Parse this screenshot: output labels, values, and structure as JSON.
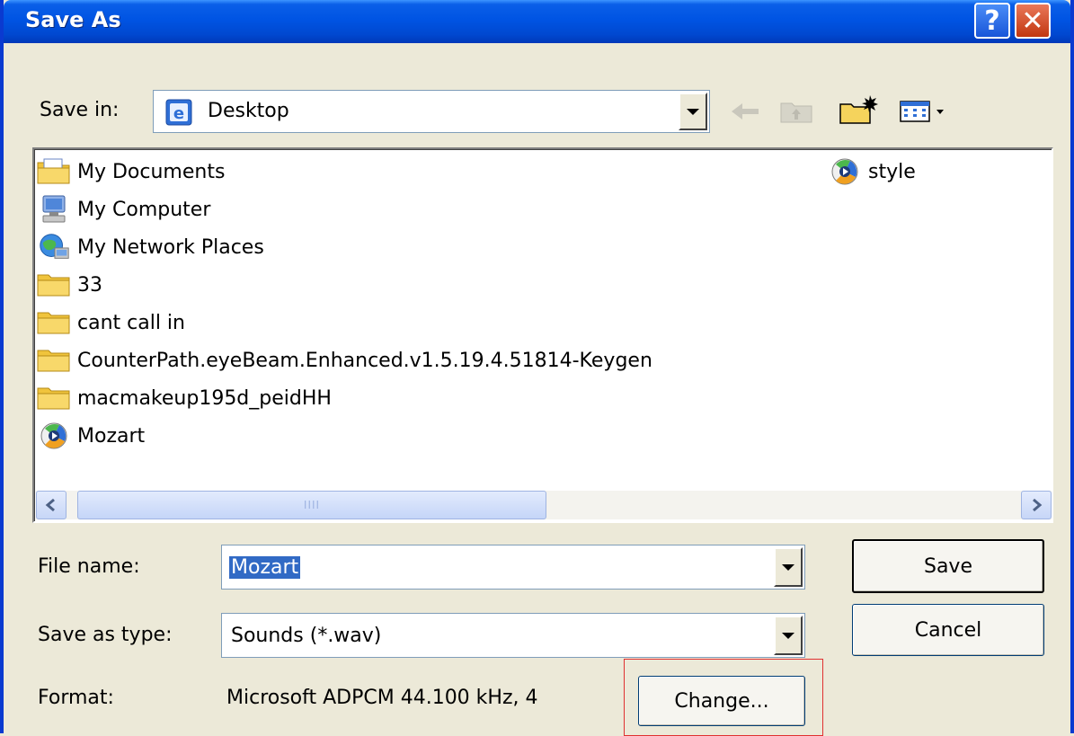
{
  "window": {
    "title": "Save As",
    "help_glyph": "?",
    "close_glyph": "✕"
  },
  "save_in": {
    "label": "Save in:",
    "value": "Desktop",
    "value_icon": "desktop-icon"
  },
  "toolbar": {
    "icons": [
      "back-arrow-icon",
      "up-folder-icon",
      "new-folder-icon",
      "views-menu-icon"
    ]
  },
  "files": {
    "left_column": [
      {
        "name": "My Documents",
        "icon": "my-documents-icon"
      },
      {
        "name": "My Computer",
        "icon": "my-computer-icon"
      },
      {
        "name": "My Network Places",
        "icon": "network-places-icon"
      },
      {
        "name": "33",
        "icon": "folder-icon"
      },
      {
        "name": "cant call in",
        "icon": "folder-icon"
      },
      {
        "name": "CounterPath.eyeBeam.Enhanced.v1.5.19.4.51814-Keygen",
        "icon": "folder-icon"
      },
      {
        "name": "macmakeup195d_peidHH",
        "icon": "folder-icon"
      },
      {
        "name": "Mozart",
        "icon": "media-file-icon"
      }
    ],
    "right_column": [
      {
        "name": "style",
        "icon": "media-file-icon"
      }
    ]
  },
  "file_name": {
    "label": "File name:",
    "value": "Mozart"
  },
  "save_as_type": {
    "label": "Save as type:",
    "value": "Sounds (*.wav)"
  },
  "format": {
    "label": "Format:",
    "value": "Microsoft ADPCM 44.100 kHz, 4"
  },
  "buttons": {
    "save": "Save",
    "cancel": "Cancel",
    "change": "Change..."
  },
  "scrollbar": {
    "grip": "IIII"
  },
  "colors": {
    "titlebar": "#0054e3",
    "selection": "#316ac5",
    "highlight_box": "#e03030"
  }
}
